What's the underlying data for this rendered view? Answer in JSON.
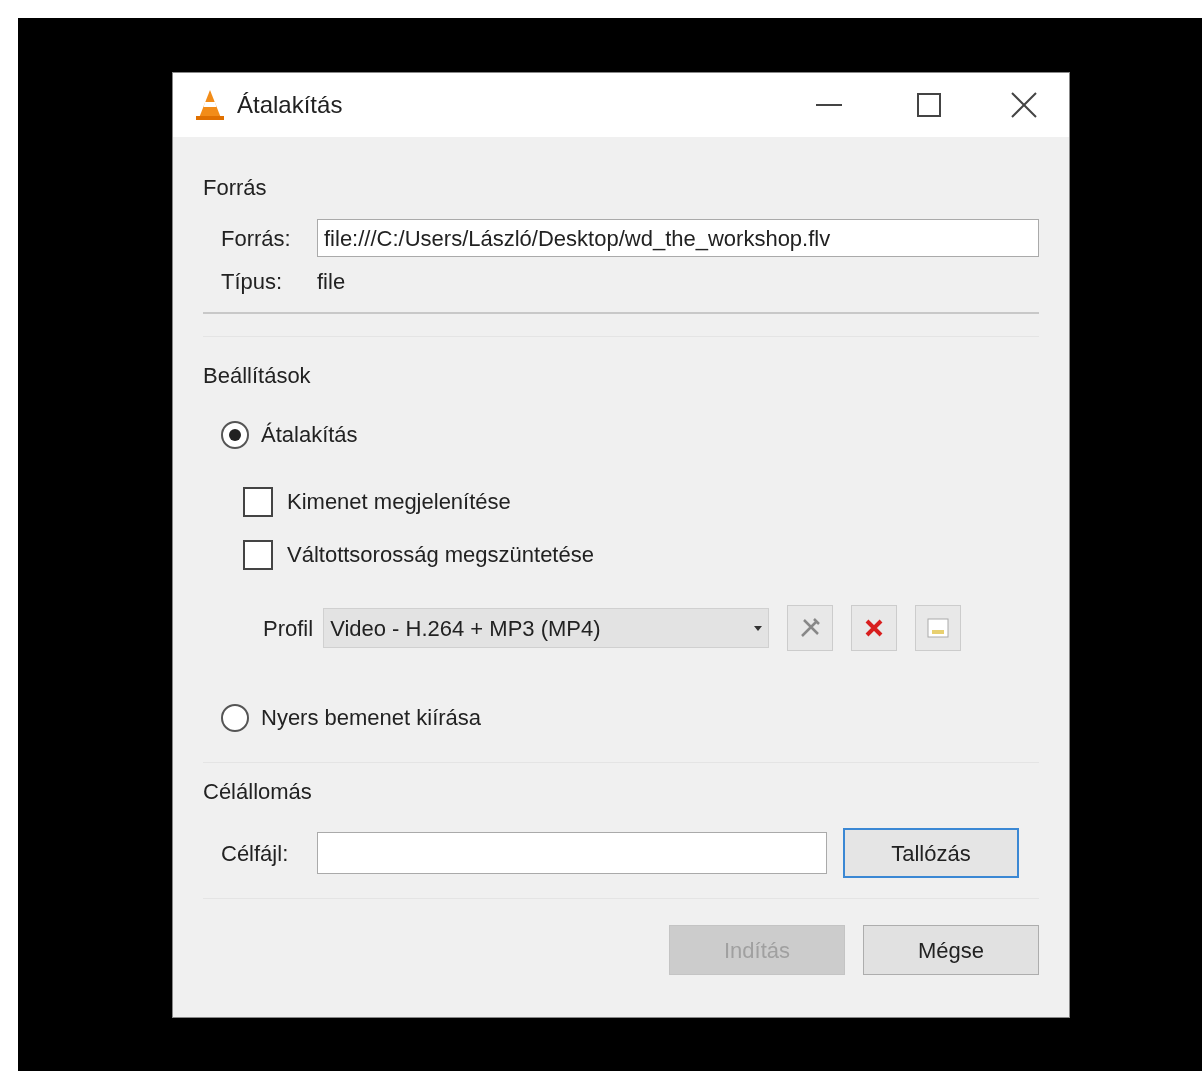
{
  "window": {
    "title": "Átalakítás"
  },
  "source": {
    "heading": "Forrás",
    "label": "Forrás:",
    "value": "file:///C:/Users/László/Desktop/wd_the_workshop.flv",
    "type_label": "Típus:",
    "type_value": "file"
  },
  "settings": {
    "heading": "Beállítások",
    "options": [
      {
        "label": "Átalakítás",
        "selected": true
      },
      {
        "label": "Nyers bemenet kiírása",
        "selected": false
      }
    ],
    "checkboxes": [
      {
        "label": "Kimenet megjelenítése",
        "checked": false
      },
      {
        "label": "Váltottsorosság megszüntetése",
        "checked": false
      }
    ],
    "profile": {
      "label": "Profil",
      "value": "Video - H.264 + MP3 (MP4)"
    }
  },
  "destination": {
    "heading": "Célállomás",
    "label": "Célfájl:",
    "browse": "Tallózás"
  },
  "buttons": [
    {
      "label": "Indítás",
      "disabled": true
    },
    {
      "label": "Mégse",
      "disabled": false
    }
  ]
}
